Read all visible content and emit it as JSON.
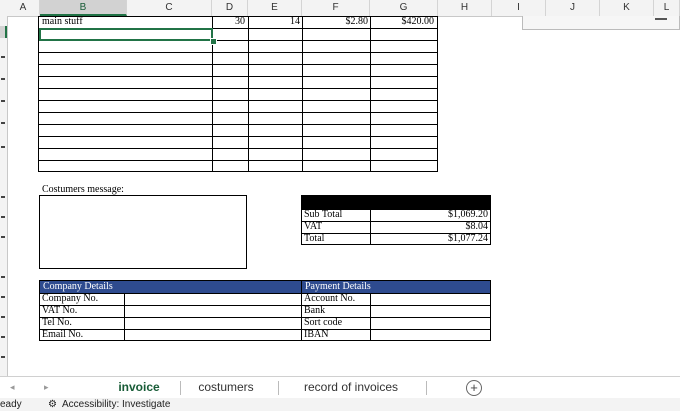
{
  "columns": [
    "A",
    "B",
    "C",
    "D",
    "E",
    "F",
    "G",
    "H",
    "I",
    "J",
    "K",
    "L"
  ],
  "first_row": {
    "desc": "main stuff",
    "qty": "30",
    "e": "14",
    "price": "$2.80",
    "total": "$420.00"
  },
  "message_label": "Costumers message:",
  "totals": [
    {
      "label": "Sub Total",
      "value": "$1,069.20"
    },
    {
      "label": "VAT",
      "value": "$8.04"
    },
    {
      "label": "Total",
      "value": "$1,077.24"
    }
  ],
  "company": {
    "header": "Company Details",
    "rows": [
      "Company No.",
      "VAT No.",
      "Tel No.",
      "Email No."
    ]
  },
  "payment": {
    "header": "Payment Details",
    "rows": [
      "Account No.",
      "Bank",
      "Sort code",
      "IBAN"
    ]
  },
  "tabs": [
    "invoice",
    "costumers",
    "record of invoices"
  ],
  "status": {
    "ready": "eady",
    "accessibility": "Accessibility: Investigate"
  },
  "colors": {
    "accent": "#217346",
    "header_blue": "#2e4b8f"
  }
}
